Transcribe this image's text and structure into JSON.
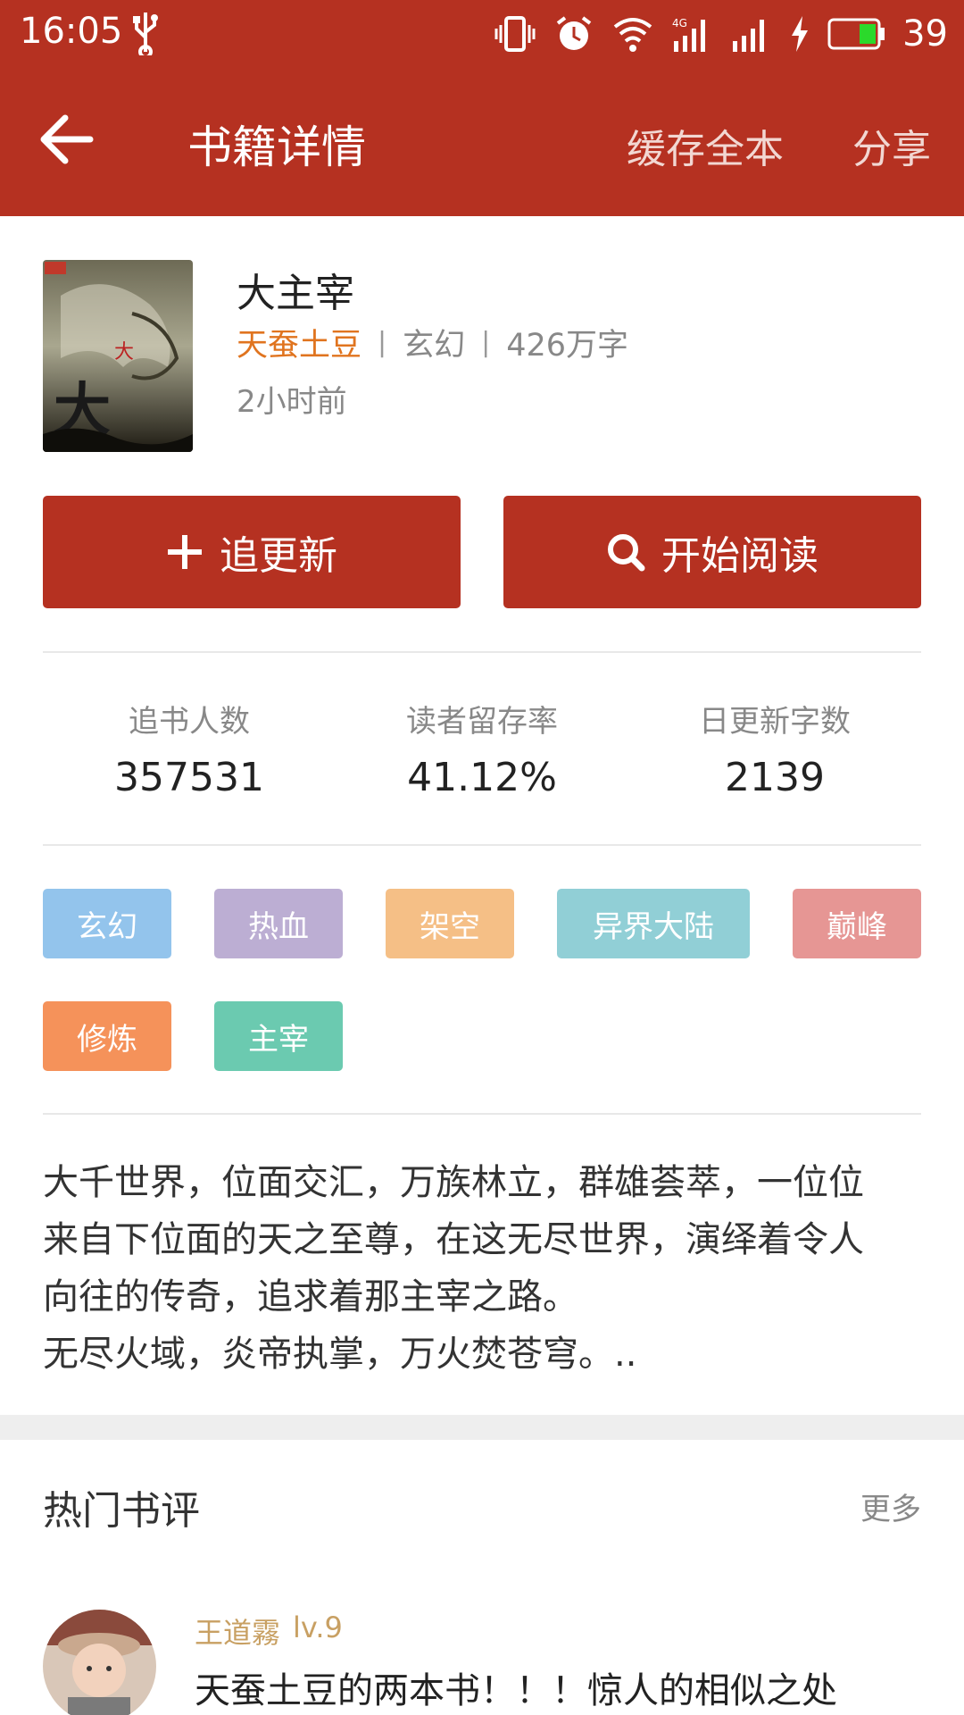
{
  "status_bar": {
    "time": "16:05",
    "battery_level": "39",
    "icons": [
      "usb-icon",
      "vibrate-icon",
      "alarm-icon",
      "wifi-icon",
      "signal-4g-icon",
      "signal-icon",
      "charging-icon",
      "battery-icon"
    ]
  },
  "header": {
    "back_icon": "back-arrow-icon",
    "title": "书籍详情",
    "cache_label": "缓存全本",
    "share_label": "分享",
    "bg_color": "#b53121"
  },
  "book": {
    "title": "大主宰",
    "author": "天蚕土豆",
    "category": "玄幻",
    "word_count": "426万字",
    "updated": "2小时前",
    "separator": "|"
  },
  "actions": {
    "follow_label": "追更新",
    "follow_icon": "plus-icon",
    "read_label": "开始阅读",
    "read_icon": "search-icon"
  },
  "stats": [
    {
      "label": "追书人数",
      "value": "357531"
    },
    {
      "label": "读者留存率",
      "value": "41.12%"
    },
    {
      "label": "日更新字数",
      "value": "2139"
    }
  ],
  "tags": [
    {
      "label": "玄幻",
      "color": "#93c4ec"
    },
    {
      "label": "热血",
      "color": "#bcaed3"
    },
    {
      "label": "架空",
      "color": "#f5bf86"
    },
    {
      "label": "异界大陆",
      "color": "#91cfd6"
    },
    {
      "label": "巅峰",
      "color": "#e69694"
    },
    {
      "label": "修炼",
      "color": "#f5925a"
    },
    {
      "label": "主宰",
      "color": "#6bcab0"
    }
  ],
  "description": [
    "大千世界，位面交汇，万族林立，群雄荟萃，一位位",
    "来自下位面的天之至尊，在这无尽世界，演绎着令人",
    "向往的传奇，追求着那主宰之路。",
    "无尽火域，炎帝执掌，万火焚苍穹。.."
  ],
  "reviews": {
    "section_title": "热门书评",
    "more_label": "更多",
    "items": [
      {
        "user": "王道霧",
        "level": "lv.9",
        "title": "天蚕土豆的两本书！！！惊人的相似之处"
      }
    ]
  }
}
